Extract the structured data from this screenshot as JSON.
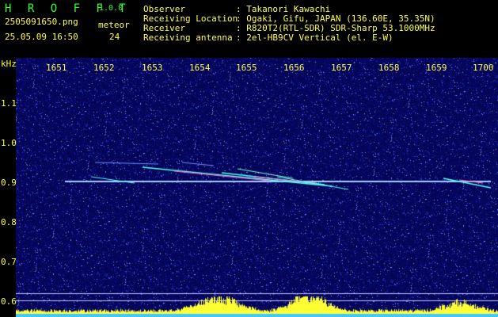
{
  "header": {
    "app_name": "H R O F F T",
    "version": "1.0.0",
    "file_name": "2505091650.png",
    "datetime": "25.05.09 16:50",
    "meteor_label": "meteor",
    "meteor_count": "24",
    "fields": [
      {
        "label": "Observer",
        "value": ": Takanori Kawachi"
      },
      {
        "label": "Receiving Location",
        "value": ": Ogaki, Gifu, JAPAN (136.60E, 35.35N)"
      },
      {
        "label": "Receiver",
        "value": ": R820T2(RTL-SDR) SDR-Sharp 53.1000MHz"
      },
      {
        "label": "Receiving antenna",
        "value": ": 2el-HB9CV Vertical (el. E-W)"
      }
    ]
  },
  "axes": {
    "y_unit": "kHz",
    "x_ticks": [
      "1651",
      "1652",
      "1653",
      "1654",
      "1655",
      "1656",
      "1657",
      "1658",
      "1659",
      "1700"
    ],
    "y_ticks": [
      "1.1",
      "1.0",
      "0.9",
      "0.8",
      "0.7",
      "0.6"
    ]
  },
  "colors": {
    "yellow": "#ffff44",
    "green": "#33ff33",
    "noise": "#0a0a78",
    "echo": "#55ffee",
    "echo_hot": "#ff66cc"
  }
}
